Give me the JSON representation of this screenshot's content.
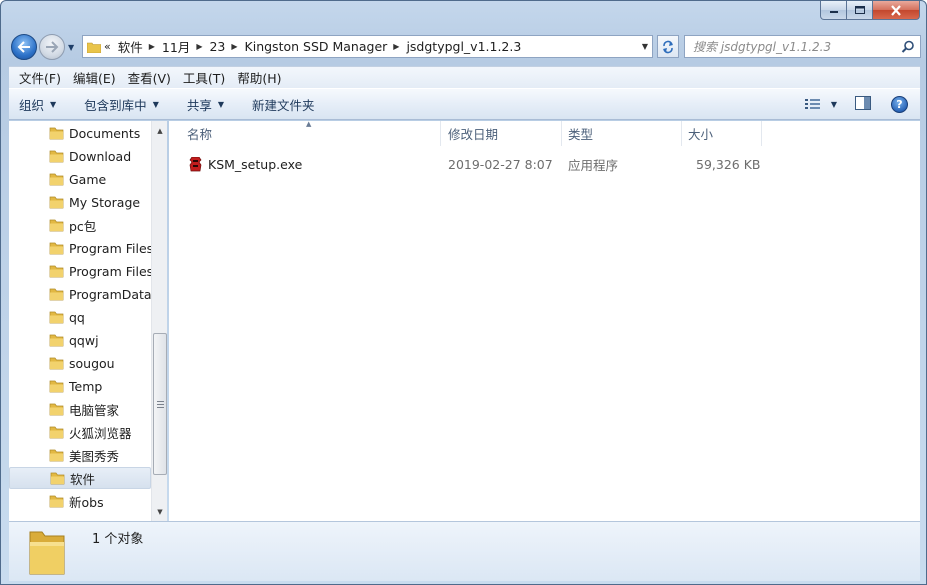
{
  "window": {
    "caption_buttons": [
      "minimize",
      "maximize",
      "close"
    ]
  },
  "nav": {
    "back_icon": "back-arrow-icon",
    "forward_icon": "forward-arrow-icon",
    "overflow": "«",
    "breadcrumbs": [
      "软件",
      "11月",
      "23",
      "Kingston SSD Manager",
      "jsdgtypgl_v1.1.2.3"
    ],
    "search_placeholder": "搜索 jsdgtypgl_v1.1.2.3"
  },
  "menubar": {
    "items": [
      "文件(F)",
      "编辑(E)",
      "查看(V)",
      "工具(T)",
      "帮助(H)"
    ]
  },
  "toolbar": {
    "organize": "组织",
    "include_in_library": "包含到库中",
    "share": "共享",
    "new_folder": "新建文件夹"
  },
  "sidebar": {
    "items": [
      {
        "label": "Documents"
      },
      {
        "label": "Download"
      },
      {
        "label": "Game"
      },
      {
        "label": "My Storage"
      },
      {
        "label": "pc包"
      },
      {
        "label": "Program Files"
      },
      {
        "label": "Program Files"
      },
      {
        "label": "ProgramData"
      },
      {
        "label": "qq"
      },
      {
        "label": "qqwj"
      },
      {
        "label": "sougou"
      },
      {
        "label": "Temp"
      },
      {
        "label": "电脑管家"
      },
      {
        "label": "火狐浏览器"
      },
      {
        "label": "美图秀秀"
      },
      {
        "label": "软件",
        "selected": true
      },
      {
        "label": "新obs"
      }
    ]
  },
  "file_list": {
    "columns": [
      "名称",
      "修改日期",
      "类型",
      "大小"
    ],
    "rows": [
      {
        "name": "KSM_setup.exe",
        "modified": "2019-02-27 8:07",
        "type": "应用程序",
        "size": "59,326 KB"
      }
    ]
  },
  "details": {
    "summary": "1 个对象"
  },
  "colors": {
    "folder": "#e9c44a",
    "accent": "#2e73c9",
    "close": "#c3472d"
  }
}
